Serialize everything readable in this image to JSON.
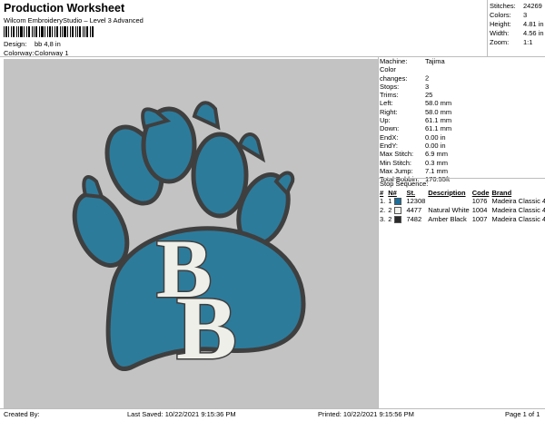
{
  "header": {
    "title": "Production Worksheet",
    "subtitle": "Wilcom EmbroideryStudio – Level 3 Advanced",
    "design_label": "Design:",
    "design_value": "bb 4,8 in",
    "colorway_label": "Colorway:",
    "colorway_value": "Colorway 1"
  },
  "top_stats": [
    {
      "label": "Stitches:",
      "value": "24269"
    },
    {
      "label": "Colors:",
      "value": "3"
    },
    {
      "label": "Height:",
      "value": "4.81 in"
    },
    {
      "label": "Width:",
      "value": "4.56 in"
    },
    {
      "label": "Zoom:",
      "value": "1:1"
    }
  ],
  "specs": [
    {
      "label": "Machine:",
      "value": "Tajima"
    },
    {
      "label": "Color changes:",
      "value": "2"
    },
    {
      "label": "Stops:",
      "value": "3"
    },
    {
      "label": "Trims:",
      "value": "25"
    },
    {
      "label": "Left:",
      "value": "58.0 mm"
    },
    {
      "label": "Right:",
      "value": "58.0 mm"
    },
    {
      "label": "Up:",
      "value": "61.1 mm"
    },
    {
      "label": "Down:",
      "value": "61.1 mm"
    },
    {
      "label": "EndX:",
      "value": "0.00 in"
    },
    {
      "label": "EndY:",
      "value": "0.00 in"
    },
    {
      "label": "Max Stitch:",
      "value": "6.9 mm"
    },
    {
      "label": "Min Stitch:",
      "value": "0.3 mm"
    },
    {
      "label": "Max Jump:",
      "value": "7.1 mm"
    },
    {
      "label": "Total Bobbin:",
      "value": "170.55ft"
    }
  ],
  "stop_sequence": {
    "title": "Stop Sequence:",
    "headers": [
      "#",
      "N#",
      "St.",
      "Description",
      "Code",
      "Brand"
    ],
    "rows": [
      {
        "num": "1.",
        "n": "1",
        "color": "#1b6f9a",
        "st": "12308",
        "desc": "",
        "code": "1076",
        "brand": "Madeira Classic 40"
      },
      {
        "num": "2.",
        "n": "2",
        "color": "#f2f2ee",
        "st": "4477",
        "desc": "Natural White",
        "code": "1004",
        "brand": "Madeira Classic 40"
      },
      {
        "num": "3.",
        "n": "2",
        "color": "#2a2a2a",
        "st": "7482",
        "desc": "Amber Black",
        "code": "1007",
        "brand": "Madeira Classic 40"
      }
    ]
  },
  "design_letters": "BB",
  "colors": {
    "paw_fill": "#2d7b9b",
    "paw_outline": "#3f3f3f",
    "letter_fill": "#efefe9",
    "canvas_bg": "#c3c3c3"
  },
  "footer": {
    "created_by": "Created By:",
    "last_saved": "Last Saved:  10/22/2021 9:15:36 PM",
    "printed": "Printed:  10/22/2021 9:15:56 PM",
    "page": "Page 1 of 1"
  }
}
